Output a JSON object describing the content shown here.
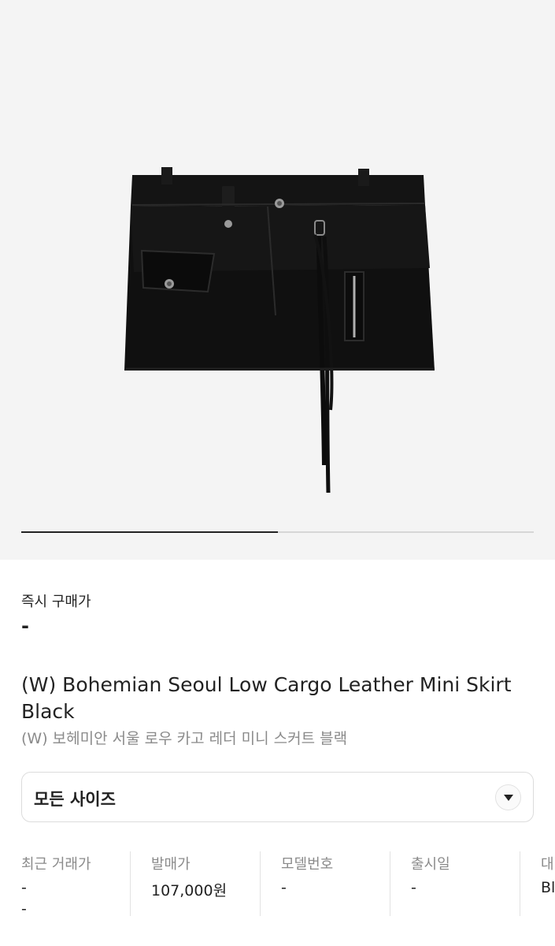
{
  "gallery": {
    "product_image": "black-leather-mini-skirt",
    "slide_progress": 0.5
  },
  "price": {
    "label": "즉시 구매가",
    "value": "-"
  },
  "product": {
    "title_en": "(W) Bohemian Seoul Low Cargo Leather Mini Skirt Black",
    "title_ko": "(W) 보헤미안 서울 로우 카고 레더 미니 스커트 블랙"
  },
  "size_select": {
    "label": "모든 사이즈",
    "icon": "chevron-down-icon"
  },
  "info": [
    {
      "label": "최근 거래가",
      "value": "-",
      "value2": "-"
    },
    {
      "label": "발매가",
      "value": "107,000원"
    },
    {
      "label": "모델번호",
      "value": "-"
    },
    {
      "label": "출시일",
      "value": "-"
    },
    {
      "label": "대",
      "value": "Bl"
    }
  ]
}
